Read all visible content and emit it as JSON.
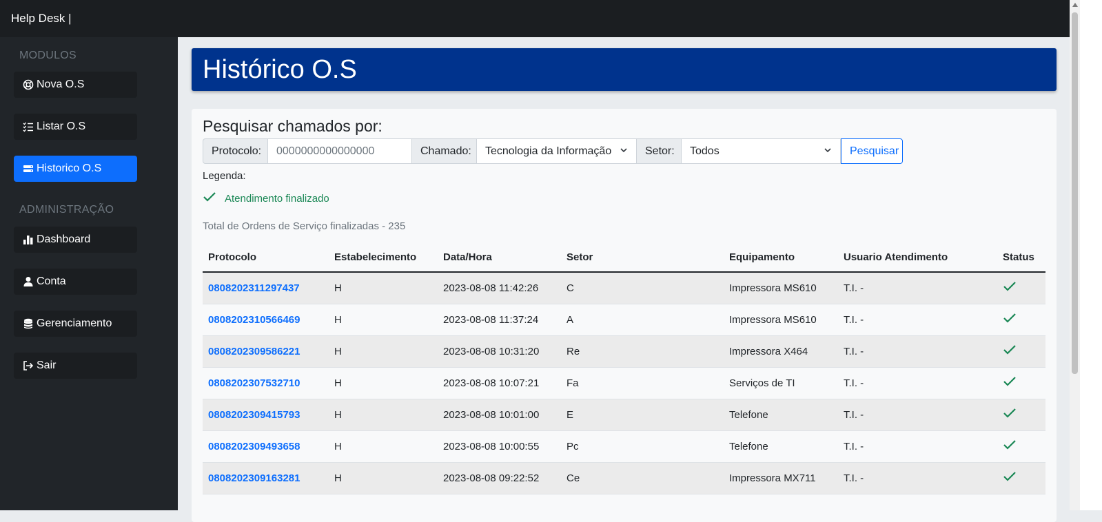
{
  "app": {
    "title": "Help Desk |"
  },
  "sidebar": {
    "sections": [
      {
        "title": "MODULOS",
        "items": [
          {
            "label": "Nova O.S",
            "icon": "lifebuoy-icon",
            "active": false
          },
          {
            "label": "Listar O.S",
            "icon": "list-check-icon",
            "active": false
          },
          {
            "label": "Historico O.S",
            "icon": "server-icon",
            "active": true
          }
        ]
      },
      {
        "title": "ADMINISTRAÇÃO",
        "items": [
          {
            "label": "Dashboard",
            "icon": "bar-chart-icon",
            "active": false
          },
          {
            "label": "Conta",
            "icon": "person-icon",
            "active": false
          },
          {
            "label": "Gerenciamento",
            "icon": "database-icon",
            "active": false
          },
          {
            "label": "Sair",
            "icon": "logout-icon",
            "active": false
          }
        ]
      }
    ]
  },
  "page": {
    "title": "Histórico O.S",
    "search": {
      "heading": "Pesquisar chamados por:",
      "protocolo_label": "Protocolo:",
      "protocolo_placeholder": "0000000000000000",
      "chamado_label": "Chamado:",
      "chamado_value": "Tecnologia da Informação",
      "setor_label": "Setor:",
      "setor_value": "Todos",
      "button_label": "Pesquisar"
    },
    "legend": {
      "title": "Legenda:",
      "item_label": "Atendimento finalizado",
      "item_color": "#198754"
    },
    "total_text": "Total de Ordens de Serviço finalizadas - 235"
  },
  "table": {
    "headers": [
      "Protocolo",
      "Estabelecimento",
      "Data/Hora",
      "Setor",
      "Equipamento",
      "Usuario Atendimento",
      "Status"
    ],
    "rows": [
      {
        "protocolo": "0808202311297437",
        "estabelecimento": "H",
        "data": "2023-08-08 11:42:26",
        "setor": "C",
        "equipamento": "Impressora MS610",
        "usuario": "T.I. -"
      },
      {
        "protocolo": "0808202310566469",
        "estabelecimento": "H",
        "data": "2023-08-08 11:37:24",
        "setor": "A",
        "equipamento": "Impressora MS610",
        "usuario": "T.I. -"
      },
      {
        "protocolo": "0808202309586221",
        "estabelecimento": "H",
        "data": "2023-08-08 10:31:20",
        "setor": "Re",
        "equipamento": "Impressora X464",
        "usuario": "T.I. -"
      },
      {
        "protocolo": "0808202307532710",
        "estabelecimento": "H",
        "data": "2023-08-08 10:07:21",
        "setor": "Fa",
        "equipamento": "Serviços de TI",
        "usuario": "T.I. -"
      },
      {
        "protocolo": "0808202309415793",
        "estabelecimento": "H",
        "data": "2023-08-08 10:01:00",
        "setor": "E",
        "equipamento": "Telefone",
        "usuario": "T.I. -"
      },
      {
        "protocolo": "0808202309493658",
        "estabelecimento": "H",
        "data": "2023-08-08 10:00:55",
        "setor": "Pc",
        "equipamento": "Telefone",
        "usuario": "T.I. -"
      },
      {
        "protocolo": "0808202309163281",
        "estabelecimento": "H",
        "data": "2023-08-08 09:22:52",
        "setor": "Ce",
        "equipamento": "Impressora MX711",
        "usuario": "T.I. -"
      }
    ]
  },
  "colors": {
    "header_bg": "#00338d",
    "active_nav": "#0d6efd",
    "link": "#0d6efd",
    "status_check": "#198754"
  }
}
